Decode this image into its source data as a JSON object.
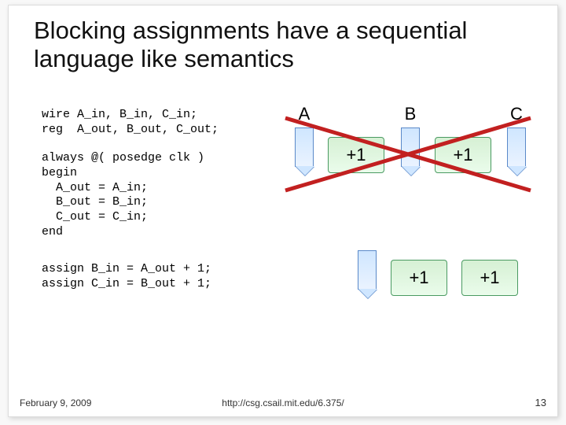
{
  "title": "Blocking assignments have a sequential language like semantics",
  "code": {
    "decl": "wire A_in, B_in, C_in;\nreg  A_out, B_out, C_out;",
    "always": "always @( posedge clk )\nbegin\n  A_out = A_in;\n  B_out = B_in;\n  C_out = C_in;\nend",
    "assigns": "assign B_in = A_out + 1;\nassign C_in = B_out + 1;"
  },
  "diagram": {
    "labels": {
      "a": "A",
      "b": "B",
      "c": "C"
    },
    "plus_top1": "+1",
    "plus_top2": "+1",
    "plus_bot1": "+1",
    "plus_bot2": "+1"
  },
  "footer": {
    "date": "February 9, 2009",
    "url": "http://csg.csail.mit.edu/6.375/",
    "page": "13"
  }
}
